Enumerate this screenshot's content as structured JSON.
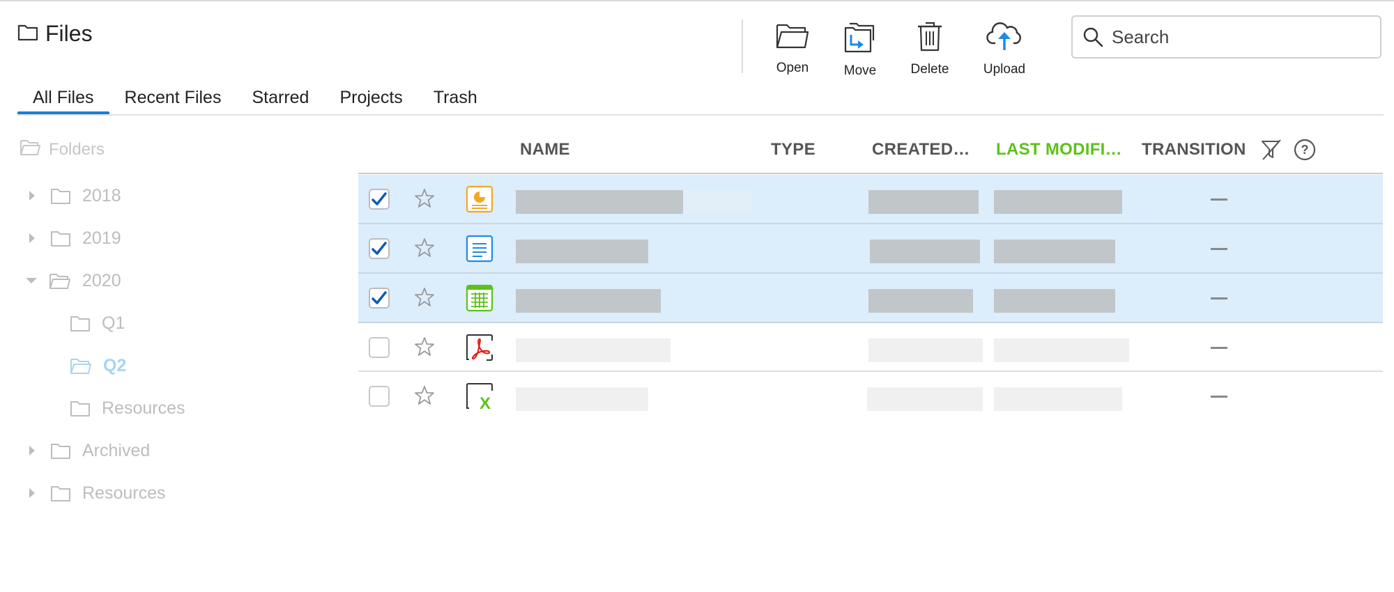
{
  "header": {
    "title": "Files",
    "toolbar": {
      "open_label": "Open",
      "move_label": "Move",
      "delete_label": "Delete",
      "upload_label": "Upload"
    },
    "search": {
      "placeholder": "Search",
      "value": ""
    }
  },
  "tabs": [
    "All Files",
    "Recent Files",
    "Starred",
    "Projects",
    "Trash"
  ],
  "active_tab": "All Files",
  "sidebar": {
    "heading": "Folders",
    "items": [
      "2018",
      "2019",
      "2020",
      "Q1",
      "Q2",
      "Resources",
      "Archived",
      "Resources"
    ],
    "expanded": "2020",
    "selected": "Q2"
  },
  "table": {
    "columns": {
      "name": "NAME",
      "type": "TYPE",
      "created": "CREATED…",
      "modified": "LAST MODIFI…",
      "transition": "TRANSITION"
    },
    "sorted_column": "LAST MODIFI…",
    "rows": [
      {
        "file_type": "presentation",
        "checked": true,
        "starred": false,
        "transition": "—"
      },
      {
        "file_type": "document",
        "checked": true,
        "starred": false,
        "transition": "—"
      },
      {
        "file_type": "spreadsheet",
        "checked": true,
        "starred": false,
        "transition": "—"
      },
      {
        "file_type": "pdf",
        "checked": false,
        "starred": false,
        "transition": "—"
      },
      {
        "file_type": "excel",
        "checked": false,
        "starred": false,
        "transition": "—"
      }
    ]
  },
  "colors": {
    "accent": "#1a7ed4",
    "sorted_header": "#5cc21a",
    "selected_row": "#dcedfc",
    "redacted": "#c1c6c9",
    "placeholder": "#f0f0f0"
  }
}
